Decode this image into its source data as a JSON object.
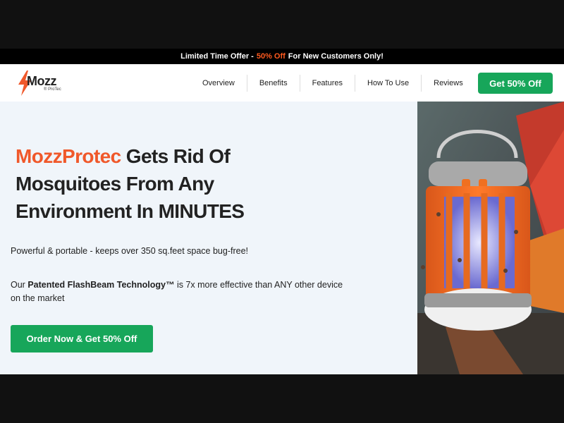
{
  "promo": {
    "prefix": "Limited Time Offer -",
    "highlight": "50% Off",
    "suffix": "For New Customers Only!"
  },
  "logo": {
    "text": "Mozz",
    "subtext": "® ProTec"
  },
  "nav": {
    "items": [
      "Overview",
      "Benefits",
      "Features",
      "How To Use",
      "Reviews"
    ],
    "cta_label": "Get 50% Off"
  },
  "hero": {
    "title_brand": "MozzProtec",
    "title_line1_rest": "Gets Rid Of",
    "title_line2": "Mosquitoes From Any",
    "title_line3": "Environment In MINUTES",
    "subtitle": "Powerful & portable - keeps over 350 sq.feet space bug-free!",
    "desc_prefix": "Our",
    "desc_bold": "Patented FlashBeam Technology™",
    "desc_suffix": "is 7x more effective than ANY other device on the market",
    "cta_label": "Order Now & Get 50% Off"
  },
  "colors": {
    "accent_orange": "#f0582a",
    "cta_green": "#17a65a",
    "hero_bg": "#f0f5fa"
  },
  "icons": {
    "logo_bolt": "lightning-bolt-icon"
  }
}
